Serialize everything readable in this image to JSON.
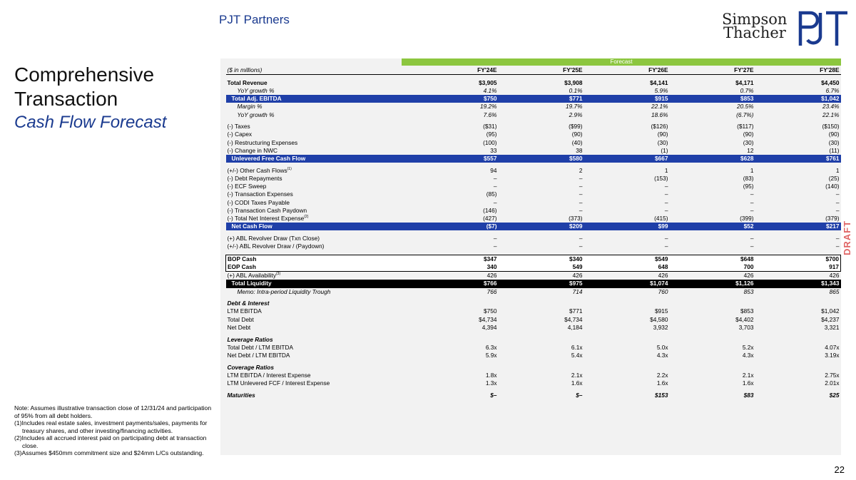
{
  "header": {
    "brand": "PJT Partners",
    "logo_line1": "Simpson",
    "logo_line2": "Thacher",
    "logo_mark": "PJT"
  },
  "title": {
    "line1": "Comprehensive",
    "line2": "Transaction",
    "subtitle": "Cash Flow Forecast"
  },
  "notes": {
    "intro": "Note: Assumes illustrative transaction close of 12/31/24 and participation of 95% from all debt holders.",
    "fn1": "(1)Includes real estate sales, investment payments/sales, payments for treasury shares, and other investing/financing activities.",
    "fn2": "(2)Includes all accrued interest paid on participating debt at transaction close.",
    "fn3": "(3)Assumes $450mm commitment size and $24mm L/Cs outstanding."
  },
  "draft": "DRAFT",
  "page_number": "22",
  "table": {
    "forecast_label": "Forecast",
    "units": "($ in millions)",
    "columns": [
      "FY'24E",
      "FY'25E",
      "FY'26E",
      "FY'27E",
      "FY'28E"
    ],
    "rows": [
      {
        "label": "Total Revenue",
        "v": [
          "$3,905",
          "$3,908",
          "$4,141",
          "$4,171",
          "$4,450"
        ]
      },
      {
        "label": "YoY growth %",
        "v": [
          "4.1%",
          "0.1%",
          "5.9%",
          "0.7%",
          "6.7%"
        ]
      },
      {
        "label": "Total Adj. EBITDA",
        "v": [
          "$750",
          "$771",
          "$915",
          "$853",
          "$1,042"
        ]
      },
      {
        "label": "Margin %",
        "v": [
          "19.2%",
          "19.7%",
          "22.1%",
          "20.5%",
          "23.4%"
        ]
      },
      {
        "label": "YoY growth %",
        "v": [
          "7.6%",
          "2.9%",
          "18.6%",
          "(6.7%)",
          "22.1%"
        ]
      },
      {
        "label": "(-) Taxes",
        "v": [
          "($31)",
          "($99)",
          "($126)",
          "($117)",
          "($150)"
        ]
      },
      {
        "label": "(-) Capex",
        "v": [
          "(95)",
          "(90)",
          "(90)",
          "(90)",
          "(90)"
        ]
      },
      {
        "label": "(-) Restructuring Expenses",
        "v": [
          "(100)",
          "(40)",
          "(30)",
          "(30)",
          "(30)"
        ]
      },
      {
        "label": "(-) Change in NWC",
        "v": [
          "33",
          "38",
          "(1)",
          "12",
          "(11)"
        ]
      },
      {
        "label": "Unlevered Free Cash Flow",
        "v": [
          "$557",
          "$580",
          "$667",
          "$628",
          "$761"
        ]
      },
      {
        "label": "(+/-) Other Cash Flows",
        "sup": "(1)",
        "v": [
          "94",
          "2",
          "1",
          "1",
          "1"
        ]
      },
      {
        "label": "(-) Debt Repayments",
        "v": [
          "–",
          "–",
          "(153)",
          "(83)",
          "(25)"
        ]
      },
      {
        "label": "(-) ECF Sweep",
        "v": [
          "–",
          "–",
          "–",
          "(95)",
          "(140)"
        ]
      },
      {
        "label": "(-) Transaction Expenses",
        "v": [
          "(85)",
          "–",
          "–",
          "–",
          "–"
        ]
      },
      {
        "label": "(-) CODI Taxes Payable",
        "v": [
          "–",
          "–",
          "–",
          "–",
          "–"
        ]
      },
      {
        "label": "(-) Transaction Cash Paydown",
        "v": [
          "(146)",
          "–",
          "–",
          "–",
          "–"
        ]
      },
      {
        "label": "(-) Total Net Interest Expense",
        "sup": "(2)",
        "v": [
          "(427)",
          "(373)",
          "(415)",
          "(399)",
          "(379)"
        ]
      },
      {
        "label": "Net Cash Flow",
        "v": [
          "($7)",
          "$209",
          "$99",
          "$52",
          "$217"
        ]
      },
      {
        "label": "(+) ABL Revolver Draw (Txn Close)",
        "v": [
          "–",
          "–",
          "–",
          "–",
          "–"
        ]
      },
      {
        "label": "(+/-) ABL Revolver Draw / (Paydown)",
        "v": [
          "–",
          "–",
          "–",
          "–",
          "–"
        ]
      },
      {
        "label": "BOP Cash",
        "v": [
          "$347",
          "$340",
          "$549",
          "$648",
          "$700"
        ]
      },
      {
        "label": "EOP Cash",
        "v": [
          "340",
          "549",
          "648",
          "700",
          "917"
        ]
      },
      {
        "label": "(+) ABL Availability",
        "sup": "(3)",
        "v": [
          "426",
          "426",
          "426",
          "426",
          "426"
        ]
      },
      {
        "label": "Total Liquidity",
        "v": [
          "$766",
          "$975",
          "$1,074",
          "$1,126",
          "$1,343"
        ]
      },
      {
        "label": "Memo: Intra-period Liquidity Trough",
        "v": [
          "766",
          "714",
          "760",
          "853",
          "865"
        ]
      },
      {
        "label": "Debt & Interest"
      },
      {
        "label": "LTM EBITDA",
        "v": [
          "$750",
          "$771",
          "$915",
          "$853",
          "$1,042"
        ]
      },
      {
        "label": "Total Debt",
        "v": [
          "$4,734",
          "$4,734",
          "$4,580",
          "$4,402",
          "$4,237"
        ]
      },
      {
        "label": "Net Debt",
        "v": [
          "4,394",
          "4,184",
          "3,932",
          "3,703",
          "3,321"
        ]
      },
      {
        "label": "Leverage Ratios"
      },
      {
        "label": "Total Debt / LTM EBITDA",
        "v": [
          "6.3x",
          "6.1x",
          "5.0x",
          "5.2x",
          "4.07x"
        ]
      },
      {
        "label": "Net Debt / LTM EBITDA",
        "v": [
          "5.9x",
          "5.4x",
          "4.3x",
          "4.3x",
          "3.19x"
        ]
      },
      {
        "label": "Coverage Ratios"
      },
      {
        "label": "LTM EBITDA / Interest Expense",
        "v": [
          "1.8x",
          "2.1x",
          "2.2x",
          "2.1x",
          "2.75x"
        ]
      },
      {
        "label": "LTM Unlevered FCF / Interest Expense",
        "v": [
          "1.3x",
          "1.6x",
          "1.6x",
          "1.6x",
          "2.01x"
        ]
      },
      {
        "label": "Maturities",
        "v": [
          "$–",
          "$–",
          "$153",
          "$83",
          "$25"
        ]
      }
    ]
  }
}
